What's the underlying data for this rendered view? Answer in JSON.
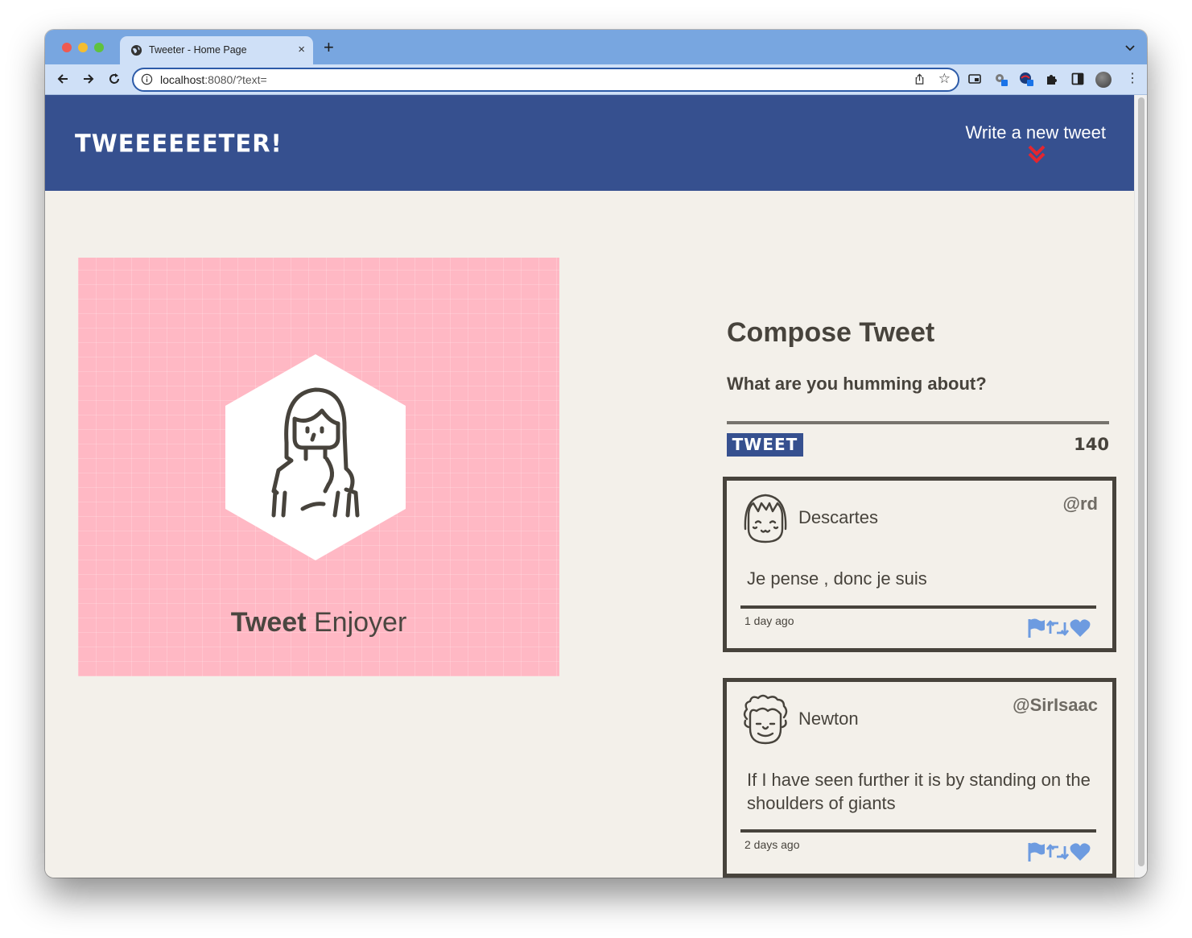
{
  "browser": {
    "tab_title": "Tweeter - Home Page",
    "new_tab": "+",
    "close_tab": "×",
    "url_host": "localhost",
    "url_rest": ":8080/?text=",
    "star": "☆",
    "menu": "⋮"
  },
  "header": {
    "brand": "TWEEEEEETER!",
    "write_link": "Write a new tweet",
    "accent_color": "#e4262f",
    "header_color": "#36508f"
  },
  "profile": {
    "title_bold": "Tweet",
    "title_rest": " Enjoyer",
    "background_color": "#ffb8c4"
  },
  "compose": {
    "title": "Compose Tweet",
    "prompt": "What are you humming about?",
    "button_label": "TWEET",
    "counter": "140"
  },
  "tweets": [
    {
      "name": "Descartes",
      "handle": "@rd",
      "text": "Je pense , donc je suis",
      "time": "1 day ago"
    },
    {
      "name": "Newton",
      "handle": "@SirIsaac",
      "text": "If I have seen further it is by standing on the shoulders of giants",
      "time": "2 days ago"
    }
  ],
  "icons": {
    "action_color": "#6d9be0",
    "actions": [
      "flag-icon",
      "retweet-icon",
      "heart-icon"
    ]
  }
}
